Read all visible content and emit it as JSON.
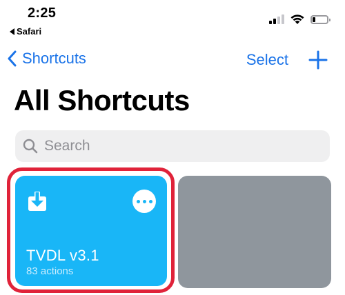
{
  "status_bar": {
    "time": "2:25",
    "back_app": "Safari",
    "signal_bars_active": 2,
    "signal_bars_total": 4,
    "battery_level": 0.2
  },
  "nav": {
    "back_label": "Shortcuts",
    "select_label": "Select",
    "add_icon": "plus-icon",
    "back_icon": "chevron-left-icon"
  },
  "page": {
    "title": "All Shortcuts"
  },
  "search": {
    "placeholder": "Search",
    "value": "",
    "icon": "search-icon"
  },
  "shortcuts": [
    {
      "title": "TVDL v3.1",
      "subtitle": "83 actions",
      "color": "#19b6f7",
      "icon": "download-icon",
      "highlighted": true
    },
    {
      "title": "",
      "subtitle": "",
      "color": "#8f969d"
    }
  ],
  "colors": {
    "accent": "#1a73e8",
    "highlight_border": "#e0233a"
  }
}
